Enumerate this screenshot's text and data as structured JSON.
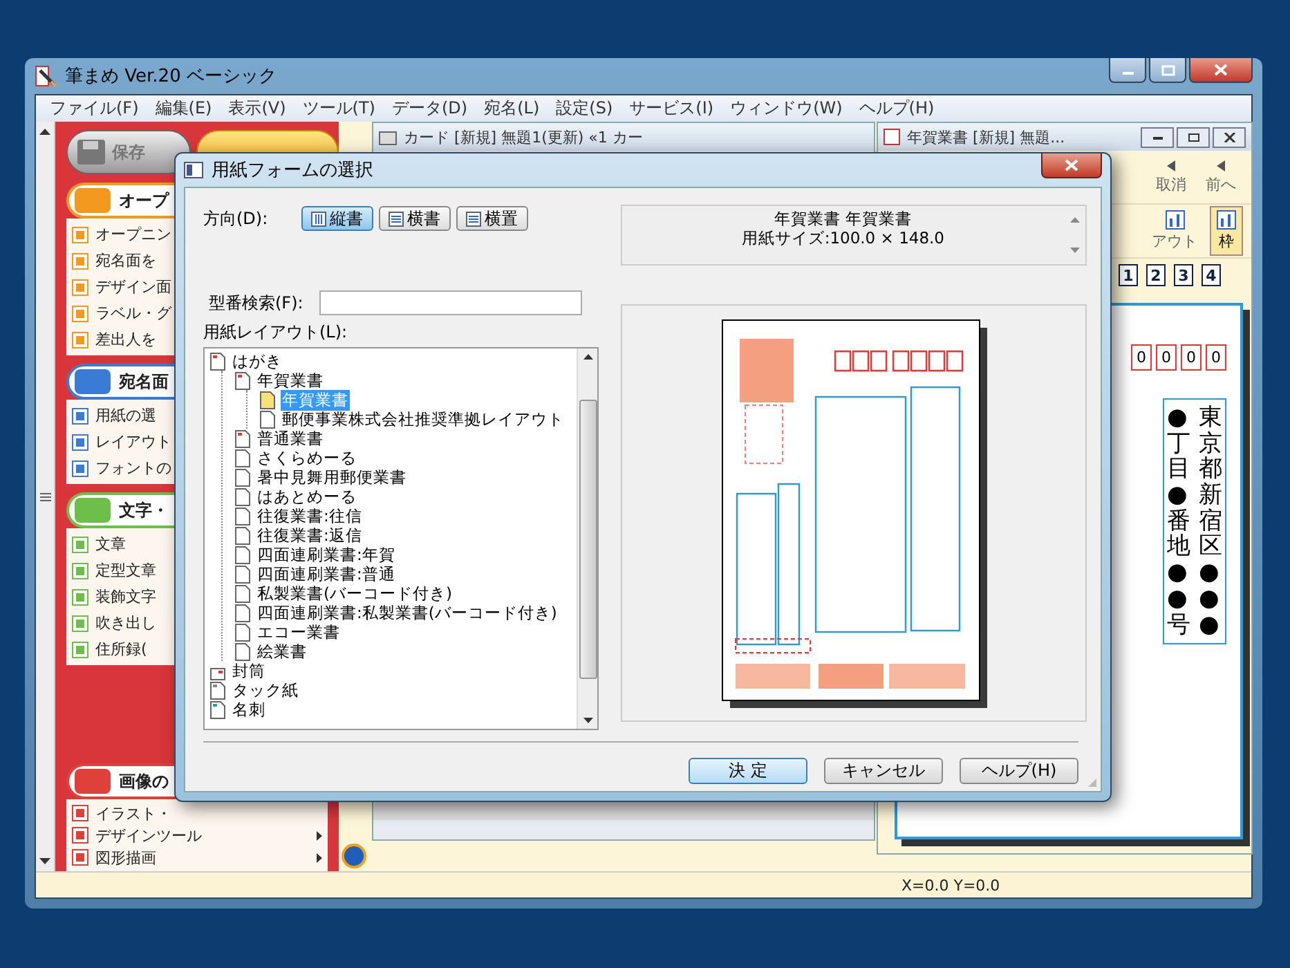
{
  "app_window": {
    "title": "筆まめ Ver.20 ベーシック",
    "menu": [
      "ファイル(F)",
      "編集(E)",
      "表示(V)",
      "ツール(T)",
      "データ(D)",
      "宛名(L)",
      "設定(S)",
      "サービス(I)",
      "ウィンドウ(W)",
      "ヘルプ(H)"
    ],
    "status_bar": {
      "coords": "X=0.0 Y=0.0"
    }
  },
  "sidebar": {
    "save_button": "保存",
    "sections": [
      {
        "heading": "オープ",
        "color": "#f39a1e",
        "items": [
          {
            "label": "オープニン",
            "arrow": false
          },
          {
            "label": "宛名面を",
            "arrow": false
          },
          {
            "label": "デザイン面",
            "arrow": false
          },
          {
            "label": "ラベル・グ",
            "arrow": false
          },
          {
            "label": "差出人を",
            "arrow": false
          }
        ]
      },
      {
        "heading": "宛名面",
        "color": "#3a7bd5",
        "items": [
          {
            "label": "用紙の選",
            "arrow": false
          },
          {
            "label": "レイアウト",
            "arrow": false
          },
          {
            "label": "フォントの",
            "arrow": false
          }
        ]
      },
      {
        "heading": "文字・",
        "color": "#6cc04a",
        "items": [
          {
            "label": "文章",
            "arrow": false
          },
          {
            "label": "定型文章",
            "arrow": false
          },
          {
            "label": "装飾文字",
            "arrow": false
          },
          {
            "label": "吹き出し",
            "arrow": false
          },
          {
            "label": "住所録(",
            "arrow": false
          }
        ]
      },
      {
        "heading": "画像の",
        "color": "#e0403a",
        "items": [
          {
            "label": "イラスト・",
            "arrow": false
          },
          {
            "label": "デザインツール",
            "arrow": true
          },
          {
            "label": "図形描画",
            "arrow": true
          }
        ]
      }
    ]
  },
  "documents": [
    {
      "title": "カード [新規] 無題1(更新) «1 カー"
    },
    {
      "title": "年賀業書 [新規] 無題...",
      "toolbar": [
        {
          "label": "取消",
          "selected": false
        },
        {
          "label": "前へ",
          "selected": false
        }
      ],
      "tools": [
        {
          "label": "アウト",
          "selected": false
        },
        {
          "label": "枠",
          "selected": true
        }
      ],
      "pages": [
        "1",
        "2",
        "3",
        "4"
      ],
      "postal_digits": [
        "0",
        "0",
        "0",
        "0"
      ],
      "address_columns": [
        "●丁目●番地●●号",
        "東京都新宿区●●●"
      ]
    }
  ],
  "dialog": {
    "title": "用紙フォームの選択",
    "orientation_label": "方向(D):",
    "orientation": [
      {
        "label": "縦書",
        "selected": true
      },
      {
        "label": "横書",
        "selected": false
      },
      {
        "label": "横置",
        "selected": false
      }
    ],
    "info_lines": [
      "年賀業書 年賀業書",
      "用紙サイズ:100.0 × 148.0"
    ],
    "search_label": "型番検索(F):",
    "tree_label": "用紙レイアウト(L):",
    "tree": [
      {
        "label": "はがき",
        "kind": "postcard",
        "selected": false,
        "children": [
          {
            "label": "年賀業書",
            "kind": "postcard",
            "selected": false,
            "children": [
              {
                "label": "年賀業書",
                "kind": "newyear",
                "selected": true
              },
              {
                "label": "郵便事業株式会社推奨準拠レイアウト",
                "kind": "page",
                "selected": false
              }
            ]
          },
          {
            "label": "普通業書",
            "kind": "postcard",
            "selected": false
          },
          {
            "label": "さくらめーる",
            "kind": "page",
            "selected": false
          },
          {
            "label": "暑中見舞用郵便業書",
            "kind": "page",
            "selected": false
          },
          {
            "label": "はあとめーる",
            "kind": "page",
            "selected": false
          },
          {
            "label": "往復業書:往信",
            "kind": "page",
            "selected": false
          },
          {
            "label": "往復業書:返信",
            "kind": "page",
            "selected": false
          },
          {
            "label": "四面連刷業書:年賀",
            "kind": "page",
            "selected": false
          },
          {
            "label": "四面連刷業書:普通",
            "kind": "page",
            "selected": false
          },
          {
            "label": "私製業書(バーコード付き)",
            "kind": "page",
            "selected": false
          },
          {
            "label": "四面連刷業書:私製業書(バーコード付き)",
            "kind": "page",
            "selected": false
          },
          {
            "label": "エコー業書",
            "kind": "page",
            "selected": false
          },
          {
            "label": "絵業書",
            "kind": "page",
            "selected": false
          }
        ]
      },
      {
        "label": "封筒",
        "kind": "envelope",
        "selected": false
      },
      {
        "label": "タック紙",
        "kind": "label",
        "selected": false
      },
      {
        "label": "名刺",
        "kind": "card",
        "selected": false
      }
    ],
    "buttons": [
      {
        "label": "決 定",
        "default": true
      },
      {
        "label": "キャンセル",
        "default": false
      },
      {
        "label": "ヘルプ(H)",
        "default": false
      }
    ]
  }
}
